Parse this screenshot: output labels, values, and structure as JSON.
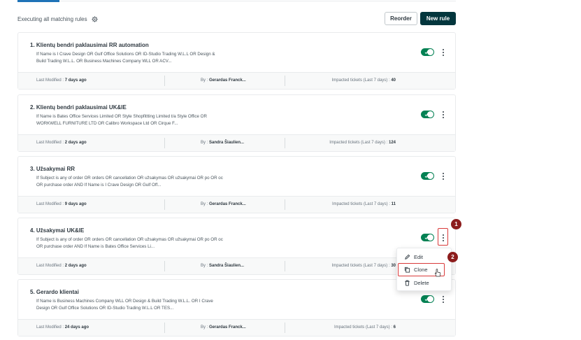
{
  "header": {
    "label": "Executing all matching rules",
    "reorder_label": "Reorder",
    "new_rule_label": "New rule"
  },
  "rules": [
    {
      "title": "1. Klientų bendri paklausimai RR automation",
      "desc_line1": "If Name is I Crave Design OR Gulf Office Solutions OR ID-Studio Trading W.L.L OR Design &",
      "desc_line2": "Build Trading W.L.L. OR Business Machines Company WLL OR ACV...",
      "modified_label": "Last Modified : ",
      "modified_value": "7 days ago",
      "by_label": "By : ",
      "by_value": "Gerardas Franck...",
      "impacted_label": "Impacted tickets (Last 7 days) : ",
      "impacted_value": "40"
    },
    {
      "title": "2. Klientų bendri paklausimai UK&IE",
      "desc_line1": "If Name is Bates Office Services Limited OR Style Shopfittting Limited t/a Style Office OR",
      "desc_line2": "WORKWELL FURNITURE LTD OR Calibro Workspace Ltd OR Cirque F...",
      "modified_label": "Last Modified : ",
      "modified_value": "2 days ago",
      "by_label": "By : ",
      "by_value": "Sandra Šiaulien...",
      "impacted_label": "Impacted tickets (Last 7 days) : ",
      "impacted_value": "124"
    },
    {
      "title": "3. Užsakymai RR",
      "desc_line1": "If Subject is any of order OR orders OR cancellation OR užsakymas OR užsakymai OR po OR oc",
      "desc_line2": "OR purchase order AND If Name is I Crave Design OR Gulf Off...",
      "modified_label": "Last Modified : ",
      "modified_value": "9 days ago",
      "by_label": "By : ",
      "by_value": "Gerardas Franck...",
      "impacted_label": "Impacted tickets (Last 7 days) : ",
      "impacted_value": "11"
    },
    {
      "title": "4. Užsakymai UK&IE",
      "desc_line1": "If Subject is any of order OR orders OR cancellation OR užsakymas OR užsakymai OR po OR oc",
      "desc_line2": "OR purchase order AND If Name is Bates Office Services Li...",
      "modified_label": "Last Modified : ",
      "modified_value": "2 days ago",
      "by_label": "By : ",
      "by_value": "Sandra Šiaulien...",
      "impacted_label": "Impacted tickets (Last 7 days) : ",
      "impacted_value": "30"
    },
    {
      "title": "5. Gerardo klientai",
      "desc_line1": "If Name is Business Machines Company WLL OR Design & Build Trading W.L.L. OR I Crave",
      "desc_line2": "Design OR Gulf Office Solutions OR ID-Studio Trading W.L.L OR TES...",
      "modified_label": "Last Modified : ",
      "modified_value": "24 days ago",
      "by_label": "By : ",
      "by_value": "Gerardas Franck...",
      "impacted_label": "Impacted tickets (Last 7 days) : ",
      "impacted_value": "6"
    }
  ],
  "menu": {
    "edit_label": "Edit",
    "clone_label": "Clone",
    "delete_label": "Delete"
  },
  "markers": {
    "first": "1",
    "second": "2"
  },
  "icons": {
    "gear": "gear-icon",
    "kebab": "more-vertical-icon",
    "edit": "pencil-icon",
    "clone": "copy-icon",
    "delete": "trash-icon",
    "cursor": "hand-pointer-icon"
  },
  "colors": {
    "toggle_on": "#038153",
    "primary_button": "#03363d",
    "annotation_red": "#d93a3a",
    "marker_red": "#8c1c1c"
  }
}
